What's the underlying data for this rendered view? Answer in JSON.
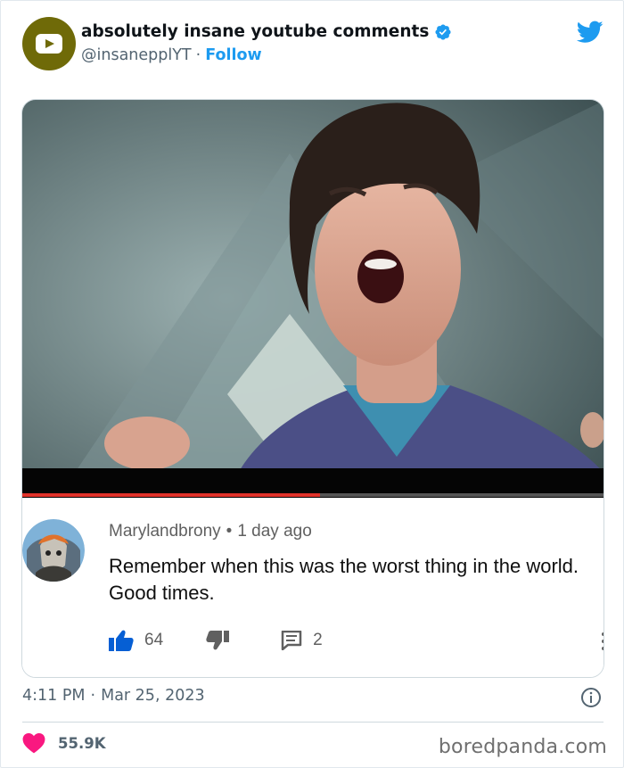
{
  "tweet": {
    "display_name": "absolutely insane youtube comments",
    "handle": "@insanepplYT",
    "separator": "·",
    "follow_label": "Follow",
    "timestamp_time": "4:11 PM",
    "timestamp_date": "Mar 25, 2023",
    "likes": "55.9K",
    "accent_color": "#1d9bf0",
    "heart_color": "#f91880",
    "avatar_color": "#6f6a08",
    "icons": {
      "verified": "verified-badge-icon",
      "twitter": "twitter-bird-icon",
      "info": "info-icon",
      "heart": "heart-icon"
    }
  },
  "video": {
    "progress_fraction": 0.51,
    "progress_color": "#e0322a"
  },
  "comment": {
    "author": "Marylandbrony",
    "separator": "•",
    "time": "1 day ago",
    "text": "Remember when this was the worst thing in the world. Good times.",
    "like_count": "64",
    "reply_count": "2",
    "icons": {
      "like": "thumbs-up-icon",
      "dislike": "thumbs-down-icon",
      "reply": "reply-icon",
      "more": "more-vertical-icon"
    }
  },
  "watermark": "boredpanda.com"
}
